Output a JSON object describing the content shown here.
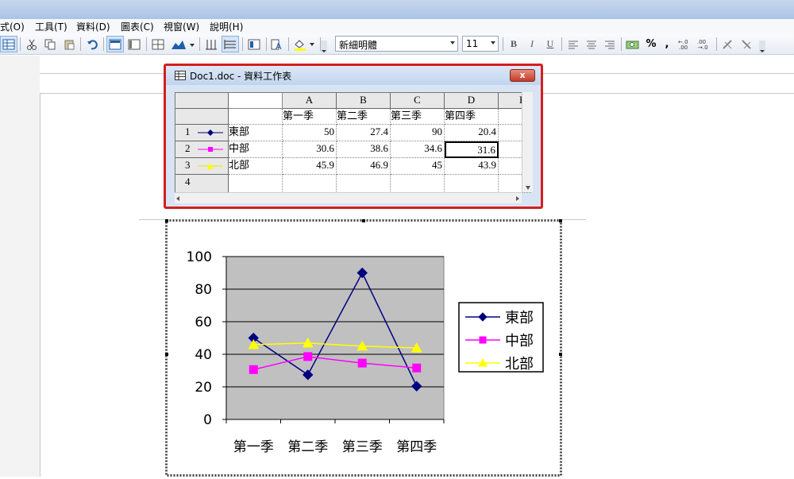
{
  "menu": {
    "items": [
      "式(O)",
      "工具(T)",
      "資料(D)",
      "圖表(C)",
      "視窗(W)",
      "說明(H)"
    ]
  },
  "toolbar": {
    "font_name": "新細明體",
    "font_size": "11",
    "bold_label": "B",
    "italic_label": "I",
    "underline_label": "U",
    "percent_label": "%",
    "comma_label": ",",
    "icons": [
      "datasheet-icon",
      "cut-icon",
      "copy-icon",
      "paste-icon",
      "undo-icon",
      "by-row-icon",
      "by-column-icon",
      "data-table-icon",
      "chart-type-icon",
      "category-axis-gridlines-icon",
      "value-axis-gridlines-icon",
      "legend-icon",
      "text-angle-icon",
      "fill-color-icon",
      "align-left-icon",
      "align-center-icon",
      "align-right-icon",
      "currency-icon",
      "increase-decimal-icon",
      "decrease-decimal-icon",
      "angle-clockwise-icon",
      "angle-counterclockwise-icon"
    ]
  },
  "datasheet": {
    "title": "Doc1.doc - 資料工作表",
    "close_label": "x",
    "columns": [
      "A",
      "B",
      "C",
      "D",
      "E"
    ],
    "header_cells": [
      "第一季",
      "第二季",
      "第三季",
      "第四季"
    ],
    "rows": [
      {
        "num": "1",
        "name": "東部",
        "values": [
          "50",
          "27.4",
          "90",
          "20.4"
        ]
      },
      {
        "num": "2",
        "name": "中部",
        "values": [
          "30.6",
          "38.6",
          "34.6",
          "31.6"
        ]
      },
      {
        "num": "3",
        "name": "北部",
        "values": [
          "45.9",
          "46.9",
          "45",
          "43.9"
        ]
      },
      {
        "num": "4",
        "name": "",
        "values": [
          "",
          "",
          "",
          ""
        ]
      }
    ]
  },
  "chart_data": {
    "type": "line",
    "categories": [
      "第一季",
      "第二季",
      "第三季",
      "第四季"
    ],
    "series": [
      {
        "name": "東部",
        "values": [
          50,
          27.4,
          90,
          20.4
        ],
        "color": "#000080",
        "marker": "diamond"
      },
      {
        "name": "中部",
        "values": [
          30.6,
          38.6,
          34.6,
          31.6
        ],
        "color": "#ff00ff",
        "marker": "square"
      },
      {
        "name": "北部",
        "values": [
          45.9,
          46.9,
          45,
          43.9
        ],
        "color": "#ffff00",
        "marker": "triangle"
      }
    ],
    "yticks": [
      "0",
      "20",
      "40",
      "60",
      "80",
      "100"
    ],
    "ylim": [
      0,
      100
    ],
    "plot_background": "#c0c0c0",
    "grid": true,
    "legend_position": "right"
  }
}
